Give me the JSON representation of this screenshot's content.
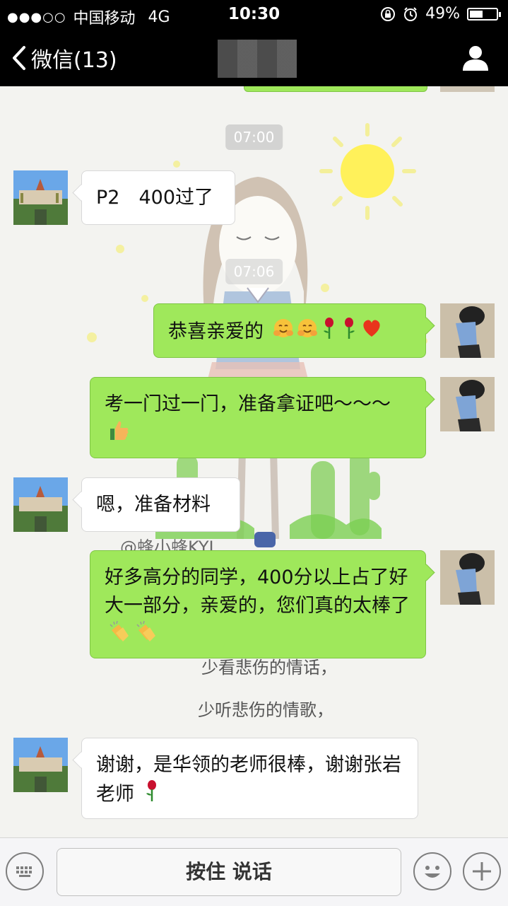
{
  "status_bar": {
    "signal_dots": "●●●○○",
    "carrier": "中国移动",
    "network": "4G",
    "time": "10:30",
    "battery_percent": "49%",
    "battery_level": 0.49
  },
  "nav": {
    "back_label": "微信(13)",
    "title_obscured": true
  },
  "chat": {
    "timestamps": [
      "07:00",
      "07:06"
    ],
    "messages": [
      {
        "side": "in",
        "text": "P2　400过了"
      },
      {
        "side": "out",
        "text": "恭喜亲爱的",
        "emojis": [
          "hugging-face-emoji",
          "hugging-face-emoji",
          "rose-emoji",
          "rose-emoji",
          "heart-emoji"
        ]
      },
      {
        "side": "out",
        "text": "考一门过一门，准备拿证吧～～～",
        "emojis": [
          "thumbs-up-emoji"
        ]
      },
      {
        "side": "in",
        "text": "嗯，准备材料"
      },
      {
        "side": "out",
        "text": "好多高分的同学，400分以上占了好大一部分，亲爱的，您们真的太棒了",
        "emojis": [
          "clapping-hands-emoji",
          "clapping-hands-emoji"
        ]
      },
      {
        "side": "in",
        "text": "谢谢，是华领的老师很棒，谢谢张岩老师",
        "emojis": [
          "rose-emoji"
        ]
      }
    ],
    "wallpaper_text": [
      "@蜂小蜂KYL",
      "少看悲伤的情话，",
      "少听悲伤的情歌，"
    ]
  },
  "input_bar": {
    "talk_label": "按住 说话"
  },
  "colors": {
    "out_bubble": "#9fe85b",
    "in_bubble": "#ffffff",
    "bar": "#000000"
  }
}
